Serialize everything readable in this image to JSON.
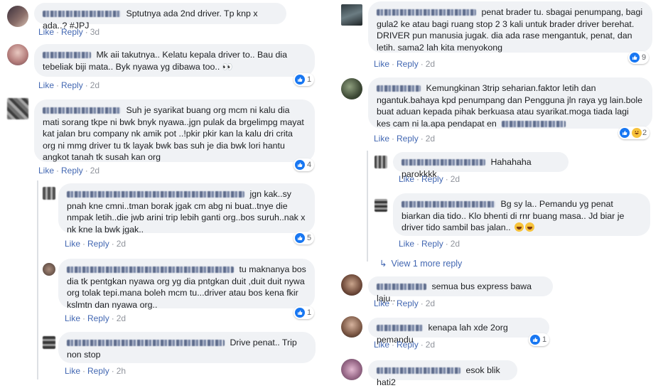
{
  "actions": {
    "like": "Like",
    "reply": "Reply"
  },
  "left": [
    {
      "id": "c1",
      "text": "Sptutnya ada 2nd driver. Tp knp x ada..? #JPJ",
      "time": "3d",
      "reactions": ""
    },
    {
      "id": "c2",
      "text": "Mk aii takutnya.. Kelatu kepala driver to.. Bau dia tebeliak biji mata.. Byk nyawa yg dibawa too..",
      "suffix": "👀",
      "time": "2d",
      "reactions": "1"
    },
    {
      "id": "c3",
      "text": "Suh je syarikat buang org mcm ni kalu dia mati sorang tkpe ni bwk bnyk nyawa..jgn pulak da brgelimpg mayat kat jalan bru company nk amik pot ..!pkir pkir kan la kalu dri crita org ni mmg driver tu tk layak bwk bas suh je dia bwk lori hantu angkot tanah tk susah kan org",
      "time": "2d",
      "reactions": "4"
    },
    {
      "id": "c4",
      "text": "jgn kak..sy pnah kne cmni..tman borak jgak cm abg ni buat..tnye die nmpak letih..die jwb arini trip lebih ganti org..bos suruh..nak x nk kne la bwk jgak..",
      "time": "2d",
      "reactions": "5"
    },
    {
      "id": "c5",
      "text": "tu maknanya bos dia tk pentgkan nyawa org yg dia pntgkan duit ,duit duit nywa org tolak tepi.mana boleh mcm tu...driver atau bos kena fkir kslmtn dan nyawa org..",
      "time": "2d",
      "reactions": "1"
    },
    {
      "id": "c6",
      "text": "Drive penat.. Trip non stop",
      "time": "2h",
      "reactions": ""
    }
  ],
  "right": [
    {
      "id": "r1",
      "text": "penat brader tu. sbagai penumpang, bagi gula2 ke atau bagi ruang stop 2 3 kali untuk brader driver berehat. DRIVER pun manusia jugak. dia ada rase mengantuk, penat, dan letih. sama2 lah kita menyokong",
      "time": "2d",
      "reactions": "9"
    },
    {
      "id": "r2",
      "text": "Kemungkinan 3trip seharian.faktor letih dan ngantuk.bahaya kpd penumpang dan Pengguna jln raya yg lain.bole buat aduan kepada pihak berkuasa atau syarikat.moga tiada lagi kes cam ni la.apa pendapat en",
      "time": "2d",
      "reactions": "2"
    },
    {
      "id": "r3",
      "text": "Hahahaha parokkkk",
      "time": "2d",
      "reactions": ""
    },
    {
      "id": "r4",
      "text": "Bg sy la.. Pemandu yg penat biarkan dia tido.. Klo bhenti di rnr buang masa.. Jd biar je driver tido sambil bas jalan..",
      "time": "2d",
      "reactions": ""
    },
    {
      "id": "r5",
      "text": "semua bus express bawa laju..",
      "time": "2d",
      "reactions": ""
    },
    {
      "id": "r6",
      "text": "kenapa lah xde 2org pemandu",
      "time": "2d",
      "reactions": "1"
    },
    {
      "id": "r7",
      "text": "esok blik hati2",
      "time": "",
      "reactions": ""
    }
  ],
  "view_more": "View 1 more reply",
  "colors": {
    "link": "#4267b2",
    "bubble": "#f0f2f5",
    "meta": "#90949c",
    "like": "#1877f2"
  }
}
